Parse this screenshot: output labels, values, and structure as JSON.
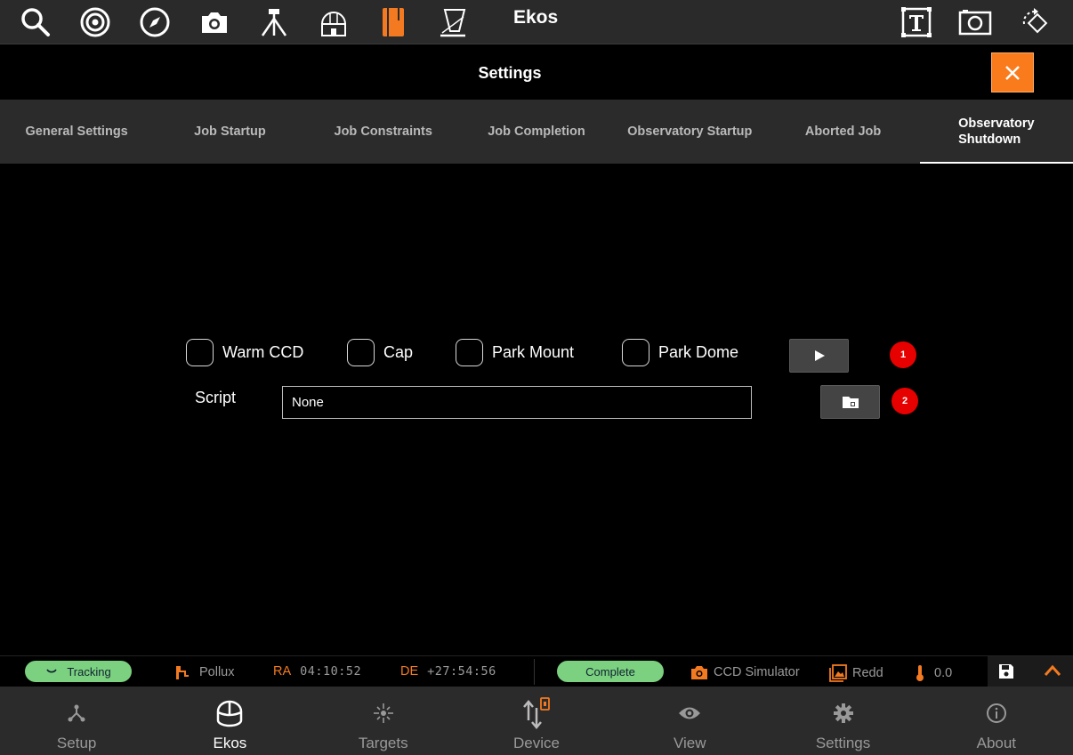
{
  "toolbar": {
    "app_title": "Ekos",
    "icons": [
      "search-icon",
      "target-icon",
      "compass-icon",
      "camera-icon",
      "tripod-icon",
      "observatory-icon",
      "notebook-icon",
      "telescope-icon",
      "text-frame-icon",
      "screenshot-icon",
      "rotate-icon"
    ],
    "accent_color": "#f37a20"
  },
  "settings": {
    "title": "Settings",
    "close_icon": "close-icon"
  },
  "tabs": [
    {
      "label": "General Settings"
    },
    {
      "label": "Job Startup"
    },
    {
      "label": "Job Constraints"
    },
    {
      "label": "Job Completion"
    },
    {
      "label": "Observatory Startup"
    },
    {
      "label": "Aborted Job"
    },
    {
      "label": "Observatory\nShutdown",
      "active": true
    }
  ],
  "shutdown": {
    "checkboxes": [
      {
        "label": "Warm CCD",
        "checked": false
      },
      {
        "label": "Cap",
        "checked": false
      },
      {
        "label": "Park Mount",
        "checked": false
      },
      {
        "label": "Park Dome",
        "checked": false
      }
    ],
    "script_label": "Script",
    "script_value": "None",
    "badge_1": "1",
    "badge_2": "2"
  },
  "status": {
    "tracking": "Tracking",
    "target": "Pollux",
    "ra_label": "RA",
    "ra_value": "04:10:52",
    "de_label": "DE",
    "de_value": "+27:54:56",
    "complete": "Complete",
    "camera": "CCD Simulator",
    "image": "Redd",
    "temperature": "0.0",
    "pill_color": "#7bd17f"
  },
  "nav": [
    {
      "label": "Setup",
      "icon": "setup-icon"
    },
    {
      "label": "Ekos",
      "icon": "ekos-icon",
      "active": true
    },
    {
      "label": "Targets",
      "icon": "targets-icon"
    },
    {
      "label": "Device",
      "icon": "device-icon"
    },
    {
      "label": "View",
      "icon": "eye-icon"
    },
    {
      "label": "Settings",
      "icon": "gear-icon"
    },
    {
      "label": "About",
      "icon": "info-icon"
    }
  ]
}
